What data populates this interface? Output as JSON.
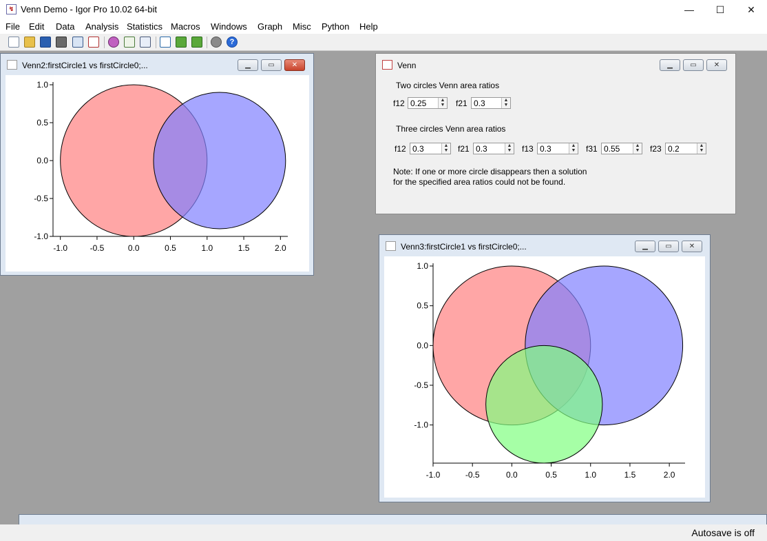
{
  "app": {
    "title": "Venn Demo - Igor Pro 10.02 64-bit",
    "icon": "igor-app-icon"
  },
  "window_controls": {
    "minimize": "—",
    "maximize": "☐",
    "close": "✕"
  },
  "menus": [
    "File",
    "Edit",
    "Data",
    "Analysis",
    "Statistics",
    "Macros",
    "Windows",
    "Graph",
    "Misc",
    "Python",
    "Help"
  ],
  "toolbar": [
    "new-doc-icon",
    "open-folder-icon",
    "save-icon",
    "print-icon",
    "table-icon",
    "graph-icon",
    "colors-icon",
    "inspect-icon",
    "browser-icon",
    "new-window-icon",
    "arrow-left-icon",
    "arrow-back-icon",
    "gear-icon",
    "help-icon"
  ],
  "venn2": {
    "title": "Venn2:firstCircle1 vs firstCircle0;...",
    "chart_data": {
      "type": "scatter",
      "x_ticks": [
        "-1.0",
        "-0.5",
        "0.0",
        "0.5",
        "1.0",
        "1.5",
        "2.0"
      ],
      "y_ticks": [
        "1.0",
        "0.5",
        "0.0",
        "-0.5",
        "-1.0"
      ],
      "xlim": [
        -1.1,
        2.1
      ],
      "ylim": [
        -1.0,
        1.0
      ],
      "circles": [
        {
          "cx": 0.0,
          "cy": 0.0,
          "r": 1.0,
          "color": "#ff8080"
        },
        {
          "cx": 1.17,
          "cy": 0.0,
          "r": 0.9,
          "color": "#8080ff"
        }
      ]
    }
  },
  "venn3": {
    "title": "Venn3:firstCircle1 vs firstCircle0;...",
    "chart_data": {
      "type": "scatter",
      "x_ticks": [
        "-1.0",
        "-0.5",
        "0.0",
        "0.5",
        "1.0",
        "1.5",
        "2.0"
      ],
      "y_ticks": [
        "1.0",
        "0.5",
        "0.0",
        "-0.5",
        "-1.0"
      ],
      "xlim": [
        -1.0,
        2.2
      ],
      "ylim": [
        -1.48,
        1.0
      ],
      "circles": [
        {
          "cx": 0.0,
          "cy": 0.0,
          "r": 1.0,
          "color": "#ff8080"
        },
        {
          "cx": 1.17,
          "cy": 0.0,
          "r": 1.0,
          "color": "#8080ff"
        },
        {
          "cx": 0.41,
          "cy": -0.74,
          "r": 0.74,
          "color": "#80ff80"
        }
      ]
    }
  },
  "panel": {
    "title": "Venn",
    "two_heading": "Two circles Venn area ratios",
    "two": [
      {
        "label": "f12",
        "value": "0.25"
      },
      {
        "label": "f21",
        "value": "0.3"
      }
    ],
    "three_heading": "Three circles Venn area ratios",
    "three": [
      {
        "label": "f12",
        "value": "0.3"
      },
      {
        "label": "f21",
        "value": "0.3"
      },
      {
        "label": "f13",
        "value": "0.3"
      },
      {
        "label": "f31",
        "value": "0.55"
      },
      {
        "label": "f23",
        "value": "0.2"
      }
    ],
    "note_line1": "Note: If one or more circle disappears then a solution",
    "note_line2": "for the specified area ratios could not be found."
  },
  "status": {
    "autosave": "Autosave is off"
  }
}
